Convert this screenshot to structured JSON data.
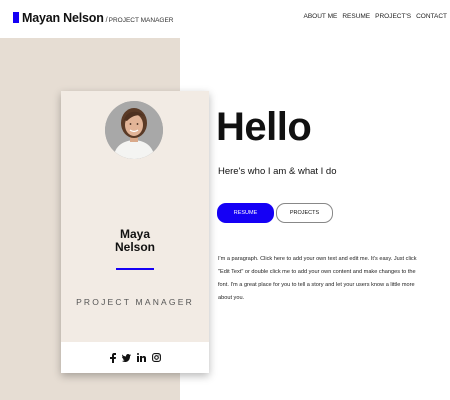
{
  "header": {
    "site_name": "Mayan Nelson",
    "separator": "/",
    "role": "PROJECT MANAGER",
    "nav": [
      "ABOUT ME",
      "RESUME",
      "PROJECT'S",
      "CONTACT"
    ],
    "brand_color": "#1500f5"
  },
  "card": {
    "first_name": "Maya",
    "last_name": "Nelson",
    "title": "PROJECT MANAGER",
    "social_icons": [
      "facebook-icon",
      "twitter-icon",
      "linkedin-icon",
      "instagram-icon"
    ]
  },
  "hero": {
    "greeting": "Hello",
    "subtitle": "Here's who I am & what I do",
    "resume_button": "RESUME",
    "projects_button": "PROJECTS",
    "paragraph": "I'm a paragraph. Click here to add your own text and edit me. It's easy. Just click \"Edit Text\" or double click me to add your own content and make changes to the font. I'm a great place for you to tell a story and let your users know a little more about you."
  }
}
